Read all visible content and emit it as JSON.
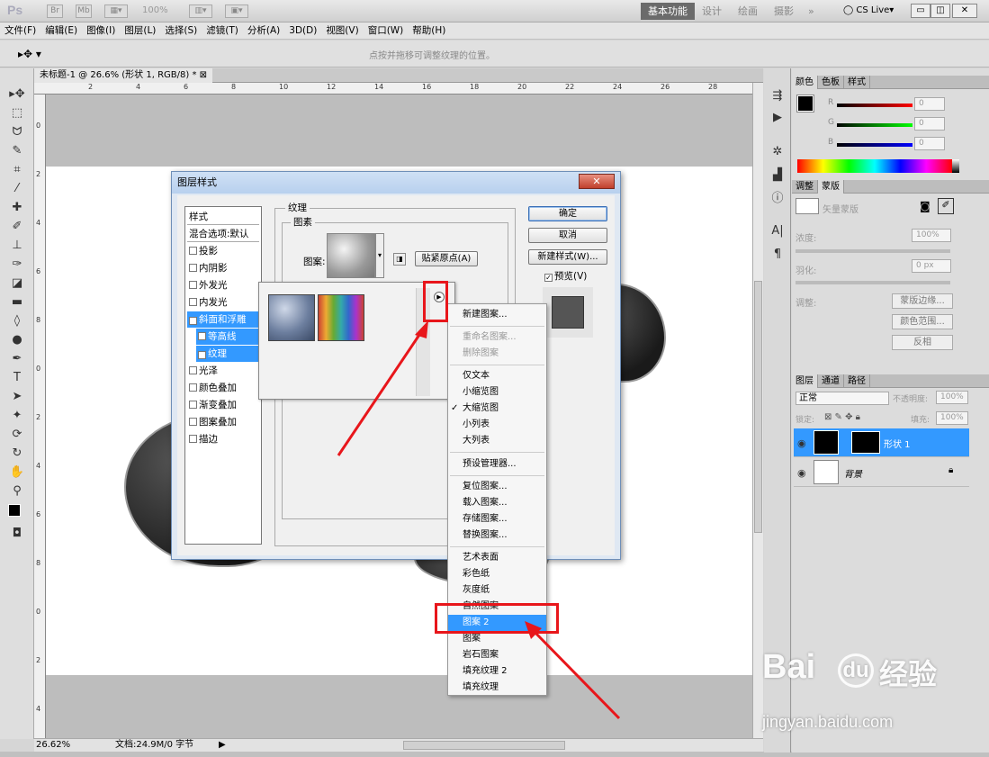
{
  "app": {
    "logo": "Ps",
    "zoom": "100%",
    "workspaces": [
      "基本功能",
      "设计",
      "绘画",
      "摄影"
    ],
    "more": "»",
    "cslive": "CS Live▾"
  },
  "menu": [
    "文件(F)",
    "编辑(E)",
    "图像(I)",
    "图层(L)",
    "选择(S)",
    "滤镜(T)",
    "分析(A)",
    "3D(D)",
    "视图(V)",
    "窗口(W)",
    "帮助(H)"
  ],
  "options": {
    "hint": "点按并拖移可调整纹理的位置。"
  },
  "document": {
    "tab": "未标题-1 @ 26.6% (形状 1, RGB/8) *",
    "ruler_h": [
      "2",
      "4",
      "6",
      "8",
      "10",
      "12",
      "14",
      "16",
      "18",
      "20",
      "22",
      "24",
      "26",
      "28"
    ],
    "ruler_v": [
      "0",
      "2",
      "4",
      "6",
      "8",
      "0",
      "2",
      "4",
      "6",
      "8",
      "0",
      "2",
      "4",
      "6"
    ]
  },
  "status": {
    "zoom": "26.62%",
    "doc": "文档:24.9M/0 字节"
  },
  "color_panel": {
    "tabs": [
      "颜色",
      "色板",
      "样式"
    ],
    "r": "R",
    "g": "G",
    "b": "B",
    "r_val": "0",
    "g_val": "0",
    "b_val": "0"
  },
  "adjust_panel": {
    "tabs": [
      "调整",
      "蒙版"
    ],
    "title": "矢量蒙版",
    "density_label": "浓度:",
    "density": "100%",
    "feather_label": "羽化:",
    "feather": "0 px",
    "refine_label": "调整:",
    "btn_edge": "蒙版边缘...",
    "btn_color": "颜色范围...",
    "btn_invert": "反相"
  },
  "layers_panel": {
    "tabs": [
      "图层",
      "通道",
      "路径"
    ],
    "blend": "正常",
    "opacity_label": "不透明度:",
    "opacity": "100%",
    "lock_label": "锁定:",
    "fill_label": "填充:",
    "fill": "100%",
    "layers": [
      {
        "name": "形状 1"
      },
      {
        "name": "背景"
      }
    ]
  },
  "dialog": {
    "title": "图层样式",
    "close": "✕",
    "styles_header": "样式",
    "blend_default": "混合选项:默认",
    "styles": [
      {
        "label": "投影",
        "checked": false
      },
      {
        "label": "内阴影",
        "checked": false
      },
      {
        "label": "外发光",
        "checked": false
      },
      {
        "label": "内发光",
        "checked": false
      },
      {
        "label": "斜面和浮雕",
        "checked": true
      },
      {
        "label": "等高线",
        "checked": false
      },
      {
        "label": "纹理",
        "checked": true
      },
      {
        "label": "光泽",
        "checked": false
      },
      {
        "label": "颜色叠加",
        "checked": false
      },
      {
        "label": "渐变叠加",
        "checked": false
      },
      {
        "label": "图案叠加",
        "checked": false
      },
      {
        "label": "描边",
        "checked": false
      }
    ],
    "group_texture": "纹理",
    "group_pattern": "图素",
    "pattern_label": "图案:",
    "snap_button": "贴紧原点(A)",
    "ok": "确定",
    "cancel": "取消",
    "new_style": "新建样式(W)...",
    "preview": "预览(V)"
  },
  "context_menu": {
    "items": [
      "新建图案...",
      "重命名图案...",
      "删除图案",
      "仅文本",
      "小缩览图",
      "大缩览图",
      "小列表",
      "大列表",
      "预设管理器...",
      "复位图案...",
      "载入图案...",
      "存储图案...",
      "替换图案...",
      "艺术表面",
      "彩色纸",
      "灰度纸",
      "自然图案",
      "图案 2",
      "图案",
      "岩石图案",
      "填充纹理 2",
      "填充纹理"
    ],
    "checked": "大缩览图",
    "selected": "图案 2"
  },
  "watermark": {
    "brand": "Bai",
    "brand2": "du",
    "cn": "经验",
    "url": "jingyan.baidu.com"
  },
  "colors": {
    "accent": "#3399ff",
    "annotation": "#e8161b"
  }
}
